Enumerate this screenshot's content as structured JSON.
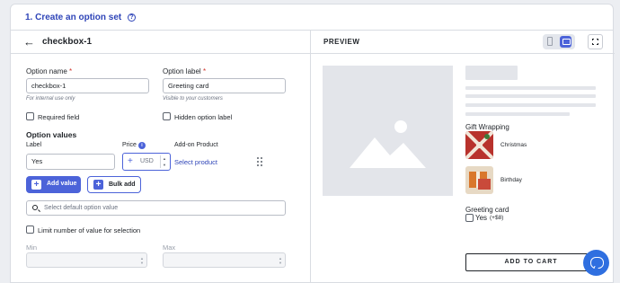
{
  "header": {
    "title": "1. Create an option set",
    "help_icon": "?"
  },
  "editor": {
    "back_icon": "←",
    "title": "checkbox-1",
    "option_name": {
      "label": "Option name",
      "required_mark": "*",
      "value": "checkbox-1",
      "hint": "For internal use only"
    },
    "option_label": {
      "label": "Option label",
      "required_mark": "*",
      "value": "Greeting card",
      "hint": "Visible to your customers"
    },
    "required_field_label": "Required field",
    "hidden_label": "Hidden option label",
    "option_values_title": "Option values",
    "columns": {
      "label": "Label",
      "price": "Price",
      "addon": "Add-on Product"
    },
    "row": {
      "label_value": "Yes",
      "price_plus": "+",
      "currency": "USD",
      "select_product": "Select product"
    },
    "add_value_label": "Add value",
    "bulk_add_label": "Bulk add",
    "default_value_placeholder": "Select default option value",
    "limit_label": "Limit number of value for selection",
    "min_label": "Min",
    "max_label": "Max"
  },
  "preview": {
    "title": "PREVIEW",
    "gift_wrapping_title": "Gift Wrapping",
    "gift_items": [
      "Christmas",
      "Birthday"
    ],
    "greeting_card_title": "Greeting card",
    "greeting_option": "Yes",
    "greeting_price": "(+$8)",
    "add_to_cart_label": "ADD TO CART"
  },
  "colors": {
    "accent": "#4c63d9",
    "title": "#2f45b8",
    "required": "#d0342c",
    "chat": "#2f6fe0"
  }
}
